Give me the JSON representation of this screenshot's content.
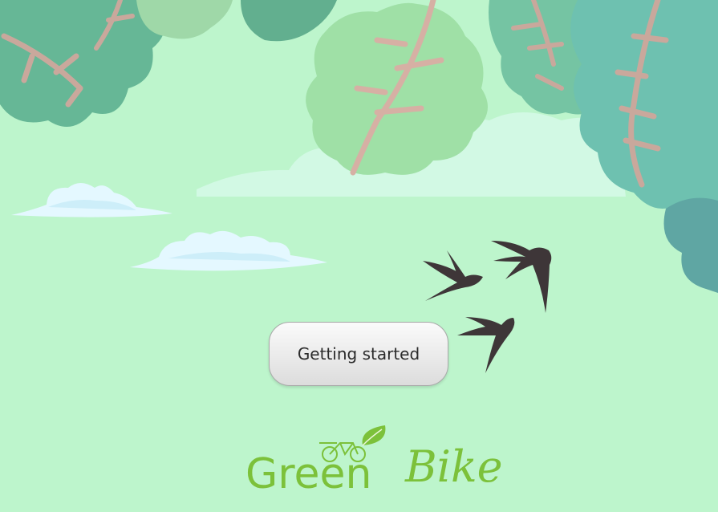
{
  "actions": {
    "primary_label": "Getting started"
  },
  "brand": {
    "part1": "Green",
    "part2": "Bike",
    "color": "#7cc13a"
  },
  "colors": {
    "sky": "#bdf5cc",
    "leaf_dark": "#66b796",
    "leaf_light": "#9fe0a6",
    "leaf_teal": "#6ec1b0",
    "branch": "#c9a89c",
    "cloud": "#e4f8ff",
    "bird": "#3e3638"
  },
  "icons": [
    "leaf-icon",
    "bicycle-icon"
  ]
}
